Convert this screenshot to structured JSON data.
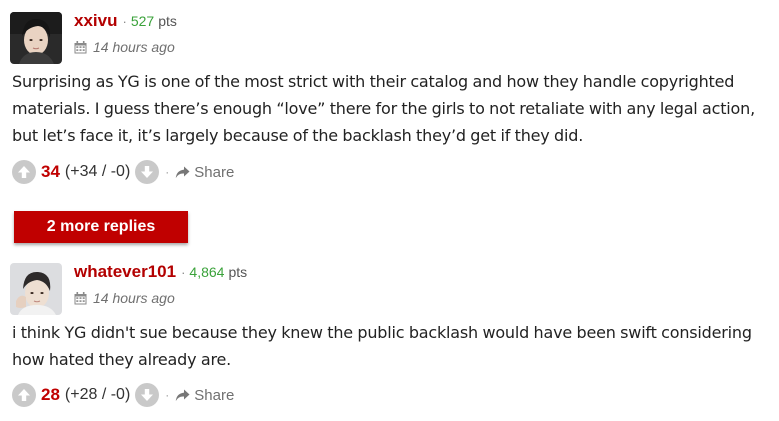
{
  "comments": [
    {
      "username": "xxivu",
      "points_value": "527",
      "points_unit": "pts",
      "separator": "·",
      "time": "14 hours ago",
      "body_lines": [
        "Surprising as YG is one of the most strict with their catalog and how they handle copyrighted",
        "materials. I guess there’s enough “love” there for the girls to not retaliate with any legal action,",
        "but let’s face it, it’s largely because of the backlash they’d get if they did."
      ],
      "score": "34",
      "vote_detail": "(+34 / -0)",
      "share_label": "Share"
    },
    {
      "username": "whatever101",
      "points_value": "4,864",
      "points_unit": "pts",
      "separator": "·",
      "time": "14 hours ago",
      "body_lines": [
        "i think YG didn't sue because they knew the public backlash would have been swift considering",
        "how hated they already are."
      ],
      "score": "28",
      "vote_detail": "(+28 / -0)",
      "share_label": "Share"
    }
  ],
  "more_replies_label": "2 more replies",
  "vote_separator": "·",
  "colors": {
    "username": "#b30000",
    "points": "#3aa23a",
    "score": "#c00000",
    "more_replies_bg": "#c00000",
    "vote_button": "#c9c9c9"
  },
  "icons": {
    "upvote": "arrow-up-icon",
    "downvote": "arrow-down-icon",
    "share": "share-arrow-icon",
    "time": "calendar-icon"
  }
}
